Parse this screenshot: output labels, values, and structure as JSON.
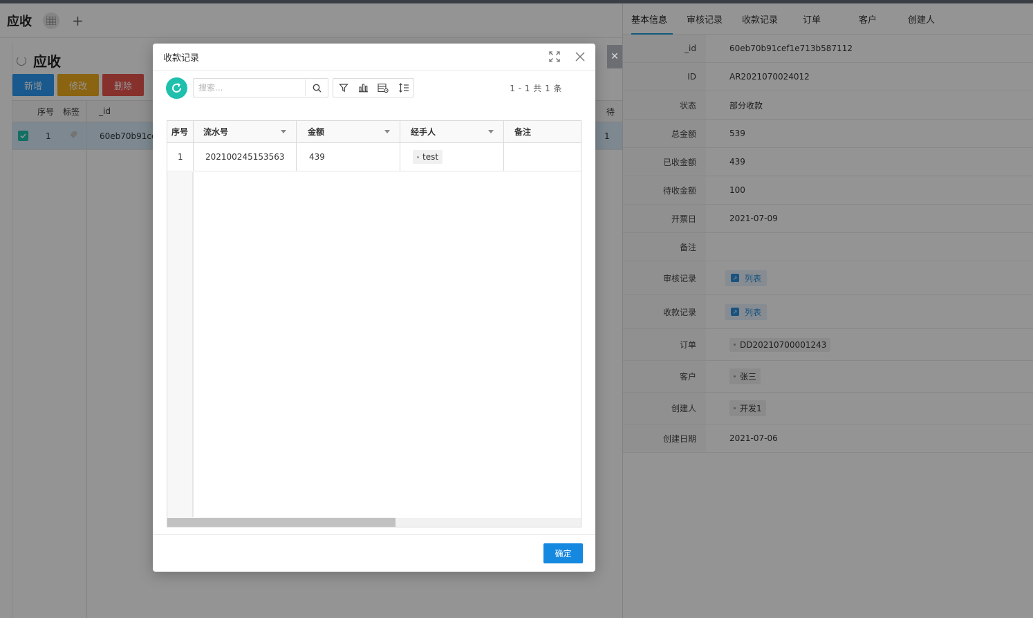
{
  "app": {
    "title": "应收",
    "page_title": "应收"
  },
  "toolbar": {
    "add_label": "新增",
    "edit_label": "修改",
    "delete_label": "删除"
  },
  "list": {
    "columns": [
      "序号",
      "标签",
      "_id",
      "待"
    ],
    "row": {
      "index": "1",
      "id": "60eb70b91ce",
      "trailing": "1"
    }
  },
  "detail": {
    "tabs": [
      "基本信息",
      "审核记录",
      "收款记录",
      "订单",
      "客户",
      "创建人"
    ],
    "fields": [
      {
        "label": "_id",
        "value": "60eb70b91cef1e713b587112"
      },
      {
        "label": "ID",
        "value": "AR2021070024012"
      },
      {
        "label": "状态",
        "value": "部分收款"
      },
      {
        "label": "总金额",
        "value": "539"
      },
      {
        "label": "已收金额",
        "value": "439"
      },
      {
        "label": "待收金额",
        "value": "100"
      },
      {
        "label": "开票日",
        "value": "2021-07-09"
      },
      {
        "label": "备注",
        "value": ""
      },
      {
        "label": "审核记录",
        "value": "列表"
      },
      {
        "label": "收款记录",
        "value": "列表"
      },
      {
        "label": "订单",
        "value": "DD20210700001243"
      },
      {
        "label": "客户",
        "value": "张三"
      },
      {
        "label": "创建人",
        "value": "开发1"
      },
      {
        "label": "创建日期",
        "value": "2021-07-06"
      }
    ]
  },
  "modal": {
    "title": "收款记录",
    "search_placeholder": "搜索...",
    "pager_text": "1 - 1  共  1  条",
    "columns": [
      "序号",
      "流水号",
      "金额",
      "经手人",
      "备注"
    ],
    "rows": [
      {
        "index": "1",
        "serial": "202100245153563",
        "amount": "439",
        "handler": "test",
        "remark": ""
      }
    ],
    "ok_label": "确定"
  },
  "colors": {
    "accent_teal": "#1fbfae",
    "primary_blue": "#1588e0",
    "btn_add": "#2b9af3",
    "btn_edit": "#f0ad1e",
    "btn_delete": "#e8554e"
  },
  "icons": [
    "grid-icon",
    "plus-icon",
    "refresh-icon",
    "search-icon",
    "filter-icon",
    "bar-chart-icon",
    "column-settings-icon",
    "row-height-icon",
    "expand-icon",
    "close-icon",
    "link-icon",
    "check-icon",
    "tag-icon"
  ]
}
